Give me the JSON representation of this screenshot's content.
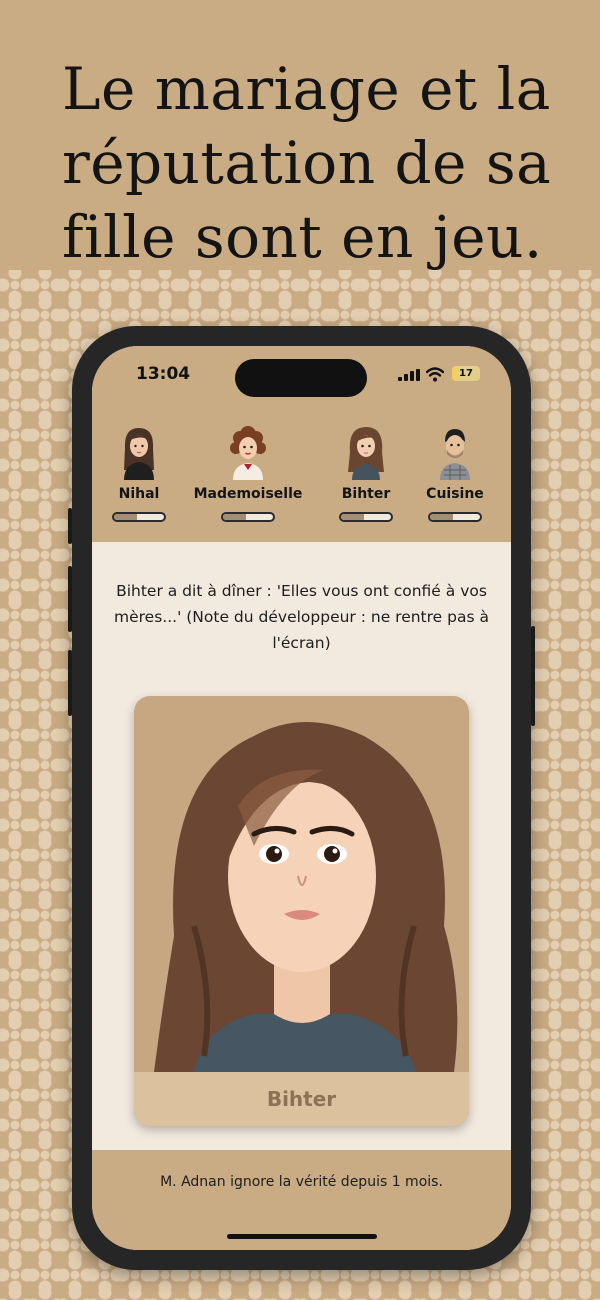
{
  "headline": "Le mariage et la réputation de sa fille sont en jeu.",
  "status_bar": {
    "time": "13:04",
    "battery": "17"
  },
  "characters": [
    {
      "name": "Nihal",
      "level": 0.45
    },
    {
      "name": "Mademoiselle",
      "level": 0.45
    },
    {
      "name": "Bihter",
      "level": 0.45
    },
    {
      "name": "Cuisine",
      "level": 0.45
    }
  ],
  "story_text": "Bihter a dit à dîner : 'Elles vous ont confié à vos mères...' (Note du développeur : ne rentre pas à l'écran)",
  "card": {
    "label": "Bihter"
  },
  "footer_text": "M. Adnan ignore la vérité depuis 1 mois.",
  "colors": {
    "background": "#c9ab84",
    "screen": "#f2e9df",
    "card": "#c7a782",
    "card_label_bg": "#dcc19e",
    "card_label_text": "#8b7456"
  },
  "icons": [
    "signal-icon",
    "wifi-icon",
    "battery-icon"
  ]
}
